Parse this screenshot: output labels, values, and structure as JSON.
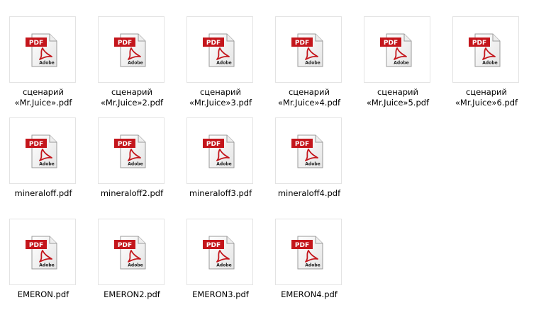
{
  "icons": {
    "file_icon": "pdf-file-icon",
    "badge_text": "PDF",
    "brand_text": "Adobe"
  },
  "colors": {
    "badge": "#c4161c",
    "acrobat": "#c4161c",
    "border": "#e3e3e3"
  },
  "rows": [
    {
      "files": [
        {
          "name": "сценарий\n«Mr.Juice».pdf"
        },
        {
          "name": "сценарий\n«Mr.Juice»2.pdf"
        },
        {
          "name": "сценарий\n«Mr.Juice»3.pdf"
        },
        {
          "name": "сценарий\n«Mr.Juice»4.pdf"
        },
        {
          "name": "сценарий\n«Mr.Juice»5.pdf"
        },
        {
          "name": "сценарий\n«Mr.Juice»6.pdf"
        }
      ]
    },
    {
      "files": [
        {
          "name": "mineraloff.pdf"
        },
        {
          "name": "mineraloff2.pdf"
        },
        {
          "name": "mineraloff3.pdf"
        },
        {
          "name": "mineraloff4.pdf"
        }
      ]
    },
    {
      "files": [
        {
          "name": "EMERON.pdf"
        },
        {
          "name": "EMERON2.pdf"
        },
        {
          "name": "EMERON3.pdf"
        },
        {
          "name": "EMERON4.pdf"
        }
      ]
    }
  ]
}
